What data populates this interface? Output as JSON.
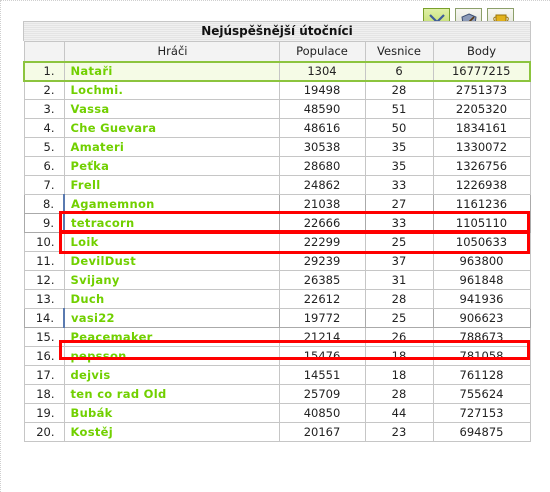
{
  "title": "Nejúspěšnější útočníci",
  "tabs": [
    {
      "icon": "crossed-swords-icon",
      "active": true
    },
    {
      "icon": "shield-icon",
      "active": false
    },
    {
      "icon": "trophy-icon",
      "active": false
    }
  ],
  "columns": {
    "players": "Hráči",
    "population": "Populace",
    "villages": "Vesnice",
    "points": "Body"
  },
  "rows": [
    {
      "rank": "1.",
      "name": "Nataři",
      "population": "1304",
      "villages": "6",
      "points": "16777215"
    },
    {
      "rank": "2.",
      "name": "Lochmi.",
      "population": "19498",
      "villages": "28",
      "points": "2751373"
    },
    {
      "rank": "3.",
      "name": "Vassa",
      "population": "48590",
      "villages": "51",
      "points": "2205320"
    },
    {
      "rank": "4.",
      "name": "Che Guevara",
      "population": "48616",
      "villages": "50",
      "points": "1834161"
    },
    {
      "rank": "5.",
      "name": "Amateri",
      "population": "30538",
      "villages": "35",
      "points": "1330072"
    },
    {
      "rank": "6.",
      "name": "Peťka",
      "population": "28680",
      "villages": "35",
      "points": "1326756"
    },
    {
      "rank": "7.",
      "name": "Frell",
      "population": "24862",
      "villages": "33",
      "points": "1226938"
    },
    {
      "rank": "8.",
      "name": "Agamemnon",
      "population": "21038",
      "villages": "27",
      "points": "1161236"
    },
    {
      "rank": "9.",
      "name": "tetracorn",
      "population": "22666",
      "villages": "33",
      "points": "1105110"
    },
    {
      "rank": "10.",
      "name": "Loik",
      "population": "22299",
      "villages": "25",
      "points": "1050633"
    },
    {
      "rank": "11.",
      "name": "DevilDust",
      "population": "29239",
      "villages": "37",
      "points": "963800"
    },
    {
      "rank": "12.",
      "name": "Svijany",
      "population": "26385",
      "villages": "31",
      "points": "961848"
    },
    {
      "rank": "13.",
      "name": "Duch",
      "population": "22612",
      "villages": "28",
      "points": "941936"
    },
    {
      "rank": "14.",
      "name": "vasi22",
      "population": "19772",
      "villages": "25",
      "points": "906623"
    },
    {
      "rank": "15.",
      "name": "Peacemaker",
      "population": "21214",
      "villages": "26",
      "points": "788673"
    },
    {
      "rank": "16.",
      "name": "pepsson",
      "population": "15476",
      "villages": "18",
      "points": "781058"
    },
    {
      "rank": "17.",
      "name": "dejvis",
      "population": "14551",
      "villages": "18",
      "points": "761128"
    },
    {
      "rank": "18.",
      "name": "ten co rad Old",
      "population": "25709",
      "villages": "28",
      "points": "755624"
    },
    {
      "rank": "19.",
      "name": "Bubák",
      "population": "40850",
      "villages": "44",
      "points": "727153"
    },
    {
      "rank": "20.",
      "name": "Kostěj",
      "population": "20167",
      "villages": "23",
      "points": "694875"
    }
  ],
  "colors": {
    "player_link": "#71d000",
    "annotation_box": "#ff0000",
    "own_row_border": "#8cc43e"
  }
}
